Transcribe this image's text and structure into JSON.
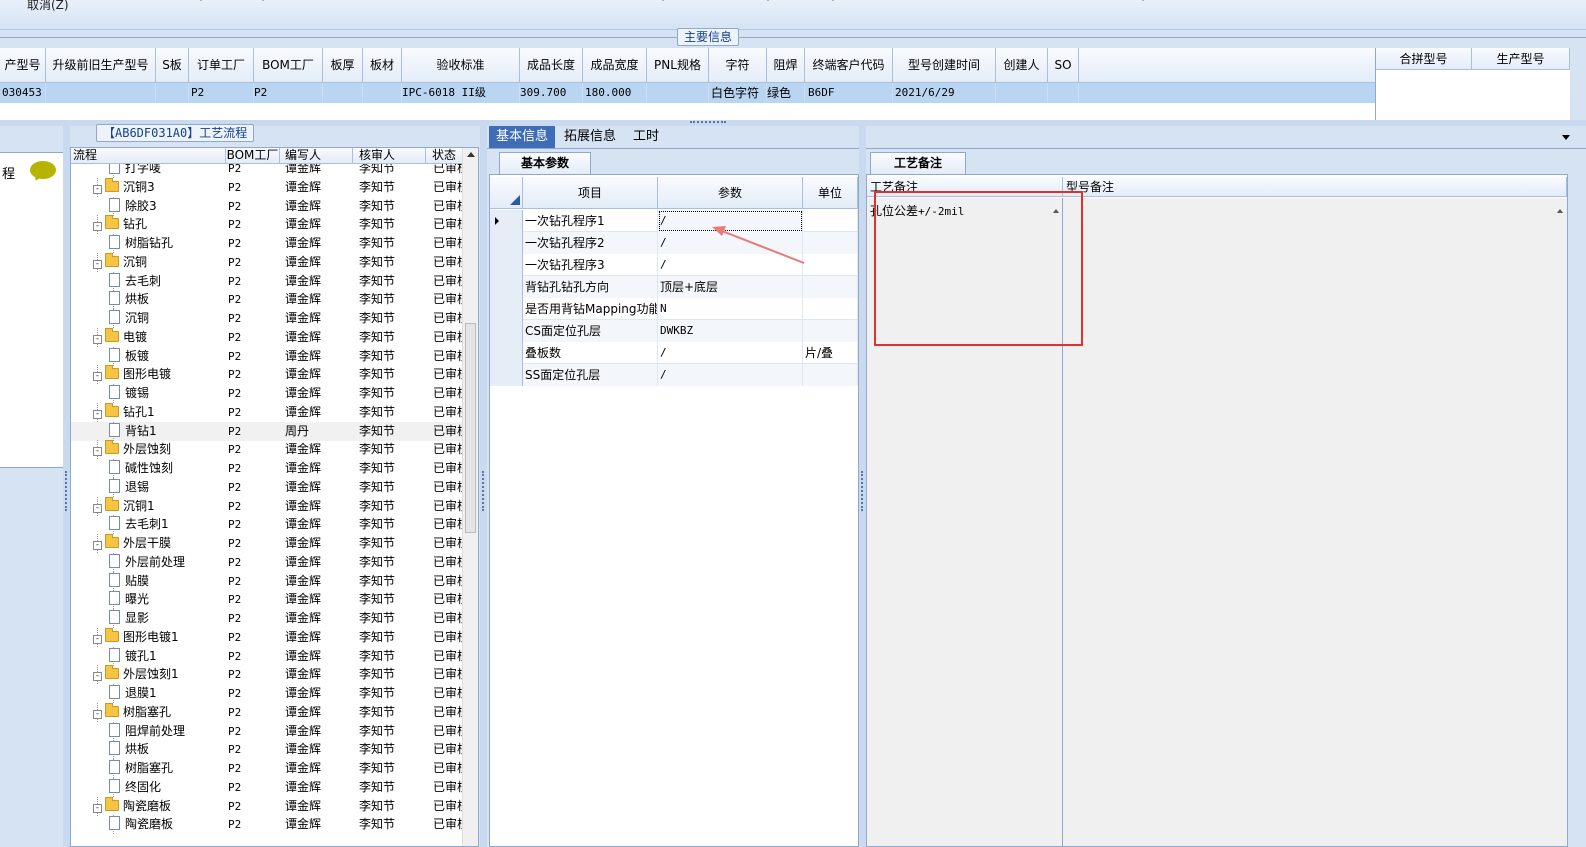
{
  "toolbar": {
    "cancel_label": "取消(Z)"
  },
  "main_info": {
    "caption": "主要信息",
    "columns": [
      "产型号",
      "升级前旧生产型号",
      "S板",
      "订单工厂",
      "BOM工厂",
      "板厚",
      "板材",
      "验收标准",
      "成品长度",
      "成品宽度",
      "PNL规格",
      "字符",
      "阻焊",
      "终端客户代码",
      "型号创建时间",
      "创建人",
      "SO"
    ],
    "row": {
      "part_no": "030453",
      "order_factory": "P2",
      "bom_factory": "P2",
      "acceptance_standard": "IPC-6018 II级",
      "finished_length": "309.700",
      "finished_width": "180.000",
      "silkscreen": "白色字符",
      "solder_mask": "绿色",
      "end_customer_code": "B6DF",
      "create_time": "2021/6/29"
    },
    "merge_columns": [
      "合拼型号",
      "生产型号"
    ]
  },
  "left_panel": {
    "label": "程"
  },
  "process_flow": {
    "caption_code": "【AB6DF031A0】",
    "caption_title": "工艺流程",
    "columns": [
      "流程",
      "BOM工厂",
      "编写人",
      "核审人",
      "状态"
    ],
    "rows": [
      {
        "name": "打字唛",
        "type": "doc",
        "factory": "P2",
        "author": "谭金辉",
        "reviewer": "李知节",
        "status": "已审核"
      },
      {
        "name": "沉铜3",
        "type": "folder",
        "factory": "P2",
        "author": "谭金辉",
        "reviewer": "李知节",
        "status": "已审核"
      },
      {
        "name": "除胶3",
        "type": "doc",
        "factory": "P2",
        "author": "谭金辉",
        "reviewer": "李知节",
        "status": "已审核"
      },
      {
        "name": "钻孔",
        "type": "folder",
        "factory": "P2",
        "author": "谭金辉",
        "reviewer": "李知节",
        "status": "已审核"
      },
      {
        "name": "树脂钻孔",
        "type": "doc",
        "factory": "P2",
        "author": "谭金辉",
        "reviewer": "李知节",
        "status": "已审核"
      },
      {
        "name": "沉铜",
        "type": "folder",
        "factory": "P2",
        "author": "谭金辉",
        "reviewer": "李知节",
        "status": "已审核"
      },
      {
        "name": "去毛刺",
        "type": "doc",
        "factory": "P2",
        "author": "谭金辉",
        "reviewer": "李知节",
        "status": "已审核"
      },
      {
        "name": "烘板",
        "type": "doc",
        "factory": "P2",
        "author": "谭金辉",
        "reviewer": "李知节",
        "status": "已审核"
      },
      {
        "name": "沉铜",
        "type": "doc",
        "factory": "P2",
        "author": "谭金辉",
        "reviewer": "李知节",
        "status": "已审核"
      },
      {
        "name": "电镀",
        "type": "folder",
        "factory": "P2",
        "author": "谭金辉",
        "reviewer": "李知节",
        "status": "已审核"
      },
      {
        "name": "板镀",
        "type": "doc",
        "factory": "P2",
        "author": "谭金辉",
        "reviewer": "李知节",
        "status": "已审核"
      },
      {
        "name": "图形电镀",
        "type": "folder",
        "factory": "P2",
        "author": "谭金辉",
        "reviewer": "李知节",
        "status": "已审核"
      },
      {
        "name": "镀锡",
        "type": "doc",
        "factory": "P2",
        "author": "谭金辉",
        "reviewer": "李知节",
        "status": "已审核"
      },
      {
        "name": "钻孔1",
        "type": "folder",
        "factory": "P2",
        "author": "谭金辉",
        "reviewer": "李知节",
        "status": "已审核"
      },
      {
        "name": "背钻1",
        "type": "doc",
        "factory": "P2",
        "author": "周丹",
        "reviewer": "李知节",
        "status": "已审核",
        "selected": true
      },
      {
        "name": "外层蚀刻",
        "type": "folder",
        "factory": "P2",
        "author": "谭金辉",
        "reviewer": "李知节",
        "status": "已审核"
      },
      {
        "name": "碱性蚀刻",
        "type": "doc",
        "factory": "P2",
        "author": "谭金辉",
        "reviewer": "李知节",
        "status": "已审核"
      },
      {
        "name": "退锡",
        "type": "doc",
        "factory": "P2",
        "author": "谭金辉",
        "reviewer": "李知节",
        "status": "已审核"
      },
      {
        "name": "沉铜1",
        "type": "folder",
        "factory": "P2",
        "author": "谭金辉",
        "reviewer": "李知节",
        "status": "已审核"
      },
      {
        "name": "去毛刺1",
        "type": "doc",
        "factory": "P2",
        "author": "谭金辉",
        "reviewer": "李知节",
        "status": "已审核"
      },
      {
        "name": "外层干膜",
        "type": "folder",
        "factory": "P2",
        "author": "谭金辉",
        "reviewer": "李知节",
        "status": "已审核"
      },
      {
        "name": "外层前处理",
        "type": "doc",
        "factory": "P2",
        "author": "谭金辉",
        "reviewer": "李知节",
        "status": "已审核"
      },
      {
        "name": "贴膜",
        "type": "doc",
        "factory": "P2",
        "author": "谭金辉",
        "reviewer": "李知节",
        "status": "已审核"
      },
      {
        "name": "曝光",
        "type": "doc",
        "factory": "P2",
        "author": "谭金辉",
        "reviewer": "李知节",
        "status": "已审核"
      },
      {
        "name": "显影",
        "type": "doc",
        "factory": "P2",
        "author": "谭金辉",
        "reviewer": "李知节",
        "status": "已审核"
      },
      {
        "name": "图形电镀1",
        "type": "folder",
        "factory": "P2",
        "author": "谭金辉",
        "reviewer": "李知节",
        "status": "已审核"
      },
      {
        "name": "镀孔1",
        "type": "doc",
        "factory": "P2",
        "author": "谭金辉",
        "reviewer": "李知节",
        "status": "已审核"
      },
      {
        "name": "外层蚀刻1",
        "type": "folder",
        "factory": "P2",
        "author": "谭金辉",
        "reviewer": "李知节",
        "status": "已审核"
      },
      {
        "name": "退膜1",
        "type": "doc",
        "factory": "P2",
        "author": "谭金辉",
        "reviewer": "李知节",
        "status": "已审核"
      },
      {
        "name": "树脂塞孔",
        "type": "folder",
        "factory": "P2",
        "author": "谭金辉",
        "reviewer": "李知节",
        "status": "已审核"
      },
      {
        "name": "阻焊前处理",
        "type": "doc",
        "factory": "P2",
        "author": "谭金辉",
        "reviewer": "李知节",
        "status": "已审核"
      },
      {
        "name": "烘板",
        "type": "doc",
        "factory": "P2",
        "author": "谭金辉",
        "reviewer": "李知节",
        "status": "已审核"
      },
      {
        "name": "树脂塞孔",
        "type": "doc",
        "factory": "P2",
        "author": "谭金辉",
        "reviewer": "李知节",
        "status": "已审核"
      },
      {
        "name": "终固化",
        "type": "doc",
        "factory": "P2",
        "author": "谭金辉",
        "reviewer": "李知节",
        "status": "已审核"
      },
      {
        "name": "陶瓷磨板",
        "type": "folder",
        "factory": "P2",
        "author": "谭金辉",
        "reviewer": "李知节",
        "status": "已审核"
      },
      {
        "name": "陶瓷磨板",
        "type": "doc",
        "factory": "P2",
        "author": "谭金辉",
        "reviewer": "李知节",
        "status": "已审核"
      }
    ]
  },
  "tabs": [
    "基本信息",
    "拓展信息",
    "工时"
  ],
  "basic_params": {
    "tab_label": "基本参数",
    "columns": [
      "项目",
      "参数",
      "单位"
    ],
    "rows": [
      {
        "item": "一次钻孔程序1",
        "value": "/",
        "unit": ""
      },
      {
        "item": "一次钻孔程序2",
        "value": "/",
        "unit": ""
      },
      {
        "item": "一次钻孔程序3",
        "value": "/",
        "unit": ""
      },
      {
        "item": "背钻孔钻孔方向",
        "value": "顶层+底层",
        "unit": ""
      },
      {
        "item": "是否用背钻Mapping功能",
        "value": "N",
        "unit": ""
      },
      {
        "item": "CS面定位孔层",
        "value": "DWKBZ",
        "unit": ""
      },
      {
        "item": "叠板数",
        "value": "/",
        "unit": "片/叠"
      },
      {
        "item": "SS面定位孔层",
        "value": "/",
        "unit": ""
      }
    ]
  },
  "process_notes": {
    "tab_label": "工艺备注",
    "columns": [
      "工艺备注",
      "型号备注"
    ],
    "process_note_prefix": "孔位公差",
    "process_note_value": "+/-2mil",
    "model_note": ""
  },
  "colors": {
    "annotation_red": "#e03030",
    "tab_active": "#3e6db5",
    "row_highlight": "#b9d5f2"
  }
}
